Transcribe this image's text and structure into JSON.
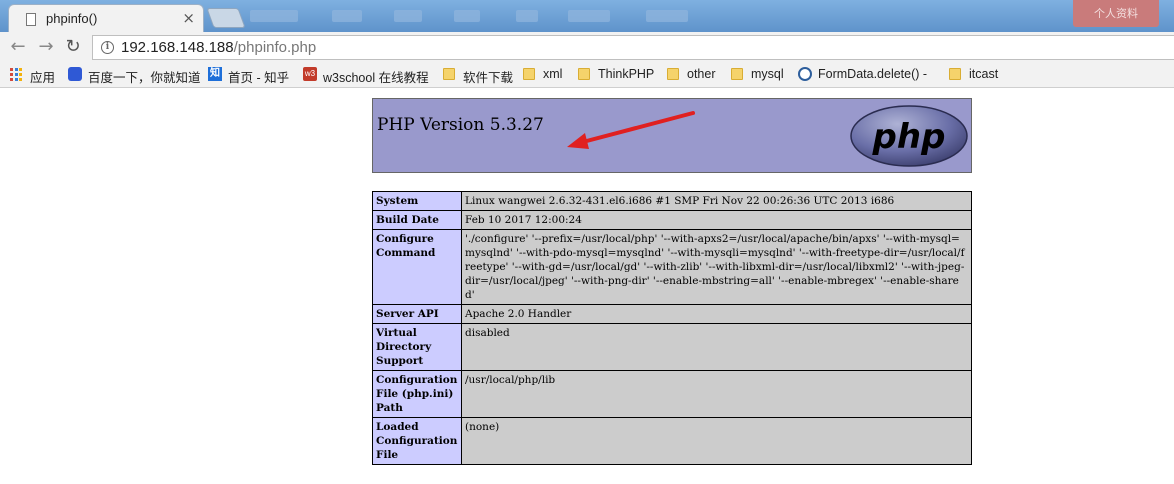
{
  "browser": {
    "tab": {
      "title": "phpinfo()",
      "close_glyph": "×"
    },
    "profile_label": "个人资料",
    "address": {
      "host": "192.168.148.188",
      "path": "/phpinfo.php"
    },
    "nav": {
      "back_glyph": "←",
      "forward_glyph": "→",
      "reload_glyph": "↻",
      "info_glyph": "i"
    },
    "bookmarks": [
      {
        "label": "应用",
        "icon": "apps-grid-icon"
      },
      {
        "label": "百度一下，你就知道",
        "icon": "baidu-icon"
      },
      {
        "label": "首页 - 知乎",
        "icon": "zhihu-icon",
        "icon_text": "知"
      },
      {
        "label": "w3school 在线教程",
        "icon": "w3school-icon",
        "icon_text": "w3"
      },
      {
        "label": "软件下载",
        "icon": "folder-icon"
      },
      {
        "label": "xml",
        "icon": "folder-icon"
      },
      {
        "label": "ThinkPHP",
        "icon": "folder-icon"
      },
      {
        "label": "other",
        "icon": "folder-icon"
      },
      {
        "label": "mysql",
        "icon": "folder-icon"
      },
      {
        "label": "FormData.delete() -",
        "icon": "page-icon"
      },
      {
        "label": "itcast",
        "icon": "folder-icon"
      }
    ]
  },
  "phpinfo": {
    "version_title": "PHP Version 5.3.27",
    "logo_text": "php",
    "header_color": "#9999cc",
    "key_color": "#ccccff",
    "value_color": "#cccccc",
    "arrow_color": "#e02020",
    "rows": [
      {
        "key": "System",
        "value": "Linux wangwei 2.6.32-431.el6.i686 #1 SMP Fri Nov 22 00:26:36 UTC 2013 i686"
      },
      {
        "key": "Build Date",
        "value": "Feb 10 2017 12:00:24"
      },
      {
        "key": "Configure Command",
        "value": "'./configure' '--prefix=/usr/local/php' '--with-apxs2=/usr/local/apache/bin/apxs' '--with-mysql=mysqlnd' '--with-pdo-mysql=mysqlnd' '--with-mysqli=mysqlnd' '--with-freetype-dir=/usr/local/freetype' '--with-gd=/usr/local/gd' '--with-zlib' '--with-libxml-dir=/usr/local/libxml2' '--with-jpeg-dir=/usr/local/jpeg' '--with-png-dir' '--enable-mbstring=all' '--enable-mbregex' '--enable-shared'"
      },
      {
        "key": "Server API",
        "value": "Apache 2.0 Handler"
      },
      {
        "key": "Virtual Directory Support",
        "value": "disabled"
      },
      {
        "key": "Configuration File (php.ini) Path",
        "value": "/usr/local/php/lib"
      },
      {
        "key": "Loaded Configuration File",
        "value": "(none)"
      }
    ]
  }
}
